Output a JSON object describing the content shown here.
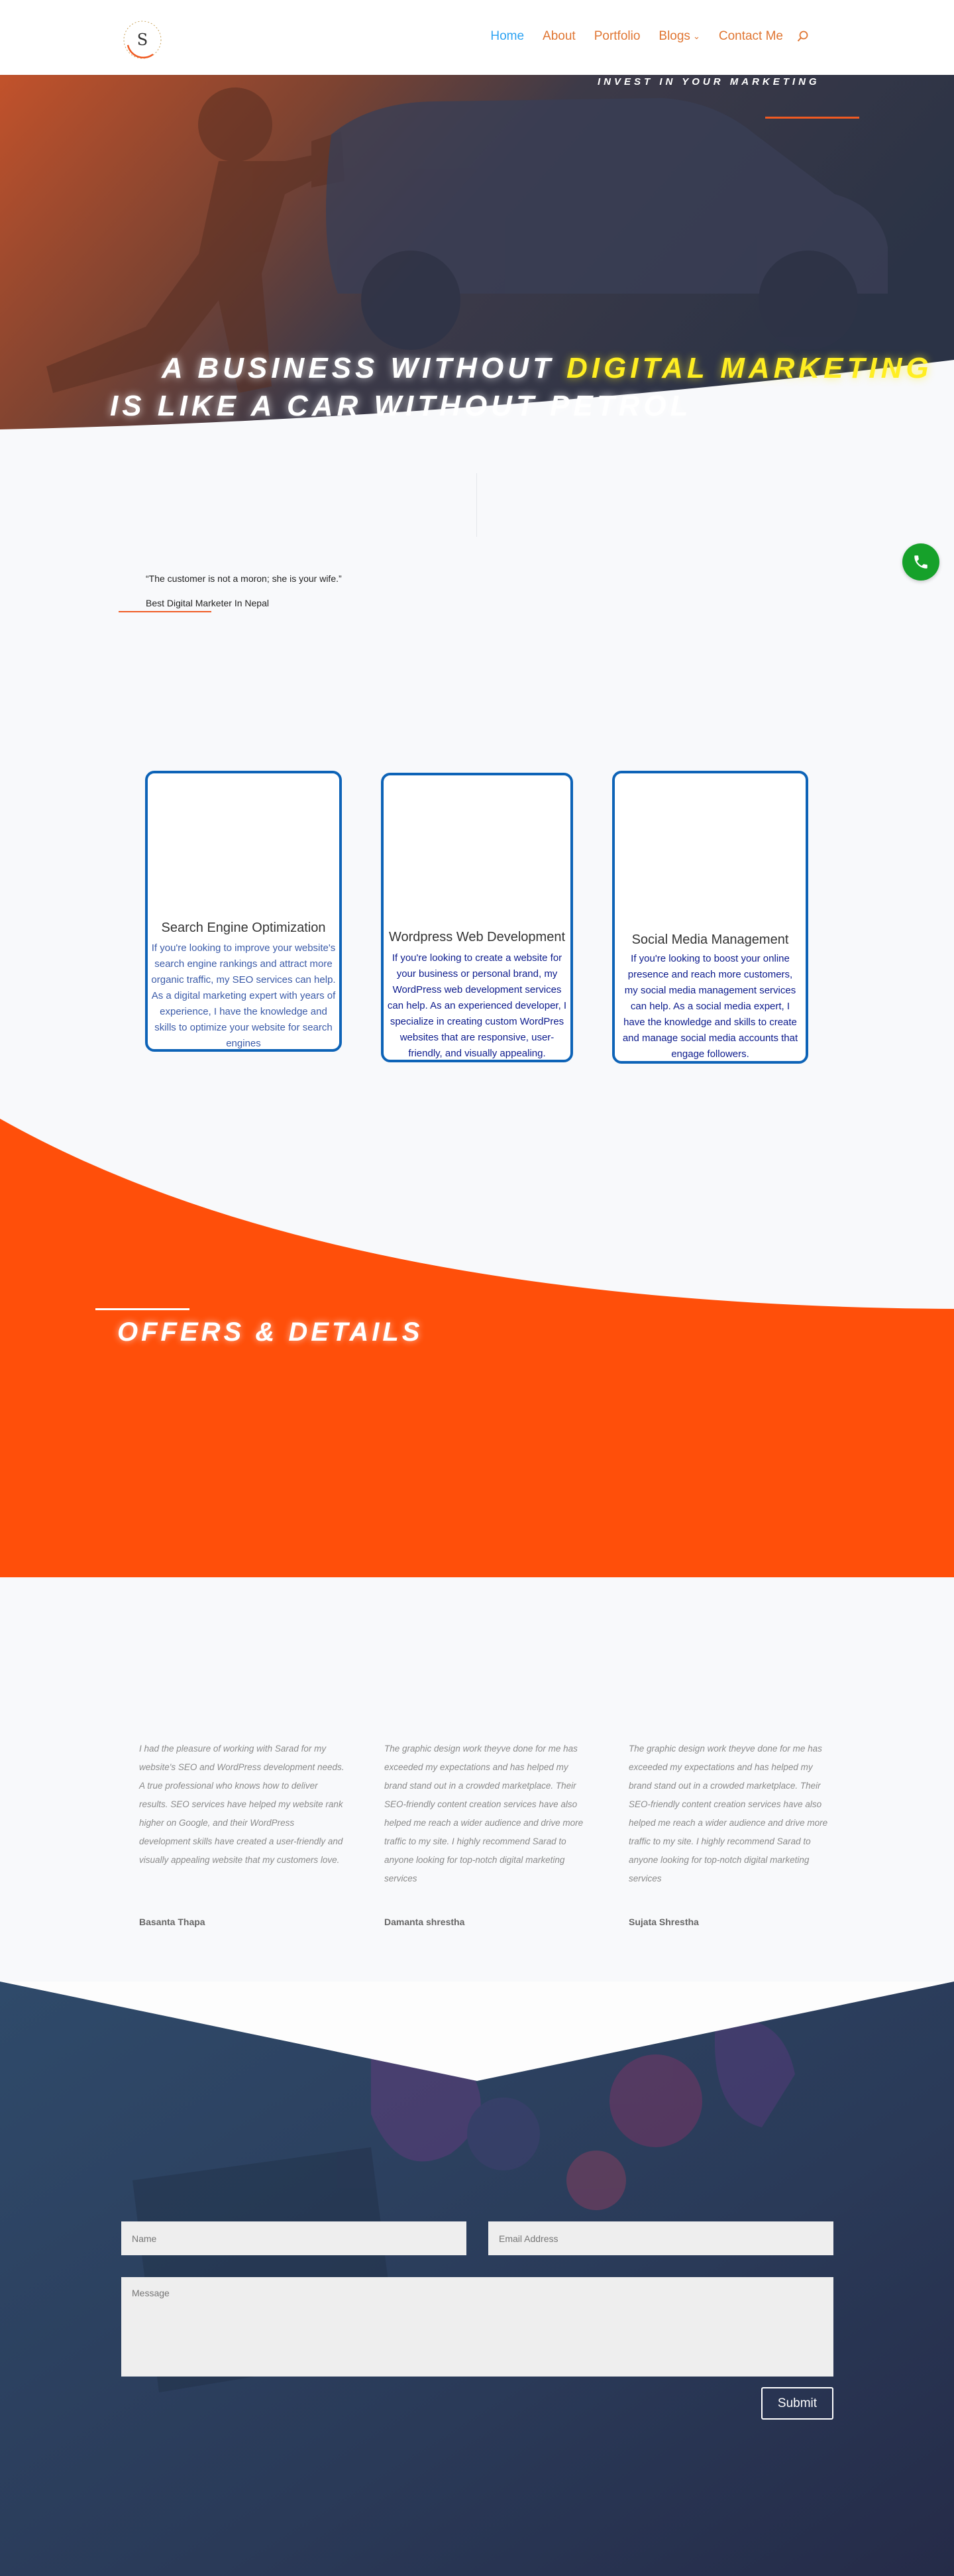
{
  "header": {
    "logo_letter": "S",
    "nav": [
      {
        "label": "Home",
        "active": true
      },
      {
        "label": "About"
      },
      {
        "label": "Portfolio"
      },
      {
        "label": "Blogs",
        "dropdown_icon": "chevron-down-icon"
      },
      {
        "label": "Contact Me"
      }
    ]
  },
  "hero": {
    "tagline": "INVEST IN YOUR MARKETING",
    "line1_white": "A BUSINESS WITHOUT ",
    "line1_yellow": "DIGITAL  MARKETING",
    "line2": "IS LIKE A CAR WITHOUT PETROL"
  },
  "about": {
    "quote": "“The customer is not a moron; she is your wife.”",
    "caption": "Best Digital Marketer In Nepal"
  },
  "services": [
    {
      "title": "Search Engine Optimization",
      "text": "If you're looking to improve your website's search engine rankings and attract more organic traffic, my SEO services can help. As a digital marketing expert with years of experience, I have the knowledge and skills to optimize your website for search engines"
    },
    {
      "title": "Wordpress Web Development",
      "text": "If you're looking to create a website for your business or personal brand, my WordPress web development services can help. As an experienced developer, I specialize in creating custom WordPres websites that are responsive, user-friendly, and visually appealing."
    },
    {
      "title": "Social Media Management",
      "text": "If you're looking to boost your online presence and reach more customers, my social media management services can help. As a social media expert, I have the knowledge and skills to create and manage social media accounts that engage followers."
    }
  ],
  "offers": {
    "title": "OFFERS & DETAILS"
  },
  "testimonials": [
    {
      "text": "I had the pleasure of working with Sarad for my website's SEO and WordPress development needs. A true professional who knows how to deliver results. SEO services have helped my website rank higher on Google, and their WordPress development skills have created a user-friendly and visually appealing website that my customers love.",
      "name": "Basanta Thapa"
    },
    {
      "text": "The graphic design work theyve done for me has exceeded my expectations and has helped my brand stand out in a crowded marketplace. Their SEO-friendly content creation services have also helped me reach a wider audience and drive more traffic to my site. I highly recommend Sarad to anyone looking for top-notch digital marketing services",
      "name": "Damanta shrestha"
    },
    {
      "text": "The graphic design work theyve done for me has exceeded my expectations and has helped my brand stand out in a crowded marketplace. Their SEO-friendly content creation services have also helped me reach a wider audience and drive more traffic to my site. I highly recommend Sarad to anyone looking for top-notch digital marketing services",
      "name": "Sujata Shrestha"
    }
  ],
  "contact": {
    "name_placeholder": "Name",
    "email_placeholder": "Email Address",
    "message_placeholder": "Message",
    "submit_label": "Submit"
  },
  "colors": {
    "accent_orange": "#f05a22",
    "offers_bg": "#ff4f0a",
    "nav_link": "#e07633",
    "nav_active": "#2ea3f2",
    "card_border": "#0d63b7",
    "hero_yellow": "#ffee22",
    "call_green": "#16a12a"
  }
}
